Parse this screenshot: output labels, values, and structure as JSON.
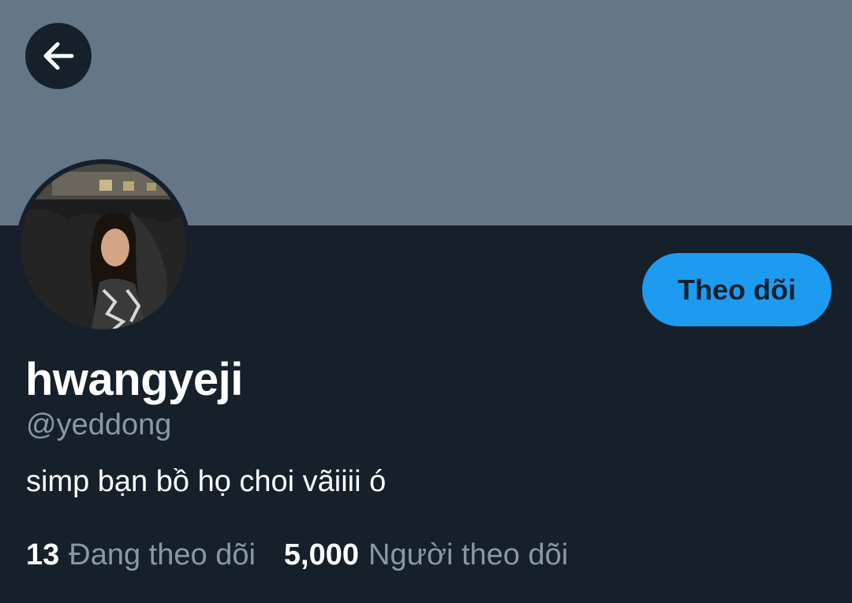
{
  "profile": {
    "display_name": "hwangyeji",
    "handle": "@yeddong",
    "bio": "simp bạn bồ họ choi vãiiii ó",
    "follow_button_label": "Theo dõi"
  },
  "stats": {
    "following_count": "13",
    "following_label": "Đang theo dõi",
    "followers_count": "5,000",
    "followers_label": "Người theo dõi"
  },
  "icons": {
    "back": "arrow-left-icon"
  },
  "colors": {
    "background": "#15202b",
    "banner": "#657787",
    "accent": "#1d9bf0",
    "secondary_text": "#8899a6",
    "primary_text": "#ffffff"
  }
}
